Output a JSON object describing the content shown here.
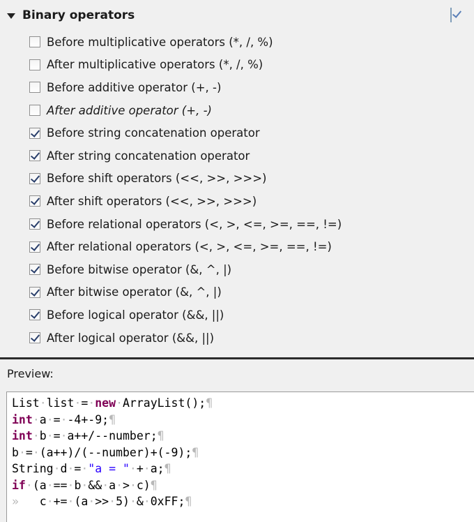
{
  "section": {
    "title": "Binary operators"
  },
  "options": [
    {
      "label": "Before multiplicative operators (*, /, %)",
      "checked": false,
      "italic": false
    },
    {
      "label": "After multiplicative operators (*, /, %)",
      "checked": false,
      "italic": false
    },
    {
      "label": "Before additive operator (+, -)",
      "checked": false,
      "italic": false
    },
    {
      "label": "After additive operator (+, -)",
      "checked": false,
      "italic": true
    },
    {
      "label": "Before string concatenation operator",
      "checked": true,
      "italic": false
    },
    {
      "label": "After string concatenation operator",
      "checked": true,
      "italic": false
    },
    {
      "label": "Before shift operators (<<, >>, >>>)",
      "checked": true,
      "italic": false
    },
    {
      "label": "After shift operators (<<, >>, >>>)",
      "checked": true,
      "italic": false
    },
    {
      "label": "Before relational operators (<, >, <=, >=, ==, !=)",
      "checked": true,
      "italic": false
    },
    {
      "label": "After relational operators (<, >, <=, >=, ==, !=)",
      "checked": true,
      "italic": false
    },
    {
      "label": "Before bitwise operator (&, ^, |)",
      "checked": true,
      "italic": false
    },
    {
      "label": "After bitwise operator (&, ^, |)",
      "checked": true,
      "italic": false
    },
    {
      "label": "Before logical operator (&&, ||)",
      "checked": true,
      "italic": false
    },
    {
      "label": "After logical operator (&&, ||)",
      "checked": true,
      "italic": false
    }
  ],
  "preview": {
    "label": "Preview:",
    "lines": [
      [
        {
          "t": "List"
        },
        {
          "t": "·",
          "c": "ws"
        },
        {
          "t": "list"
        },
        {
          "t": "·",
          "c": "ws"
        },
        {
          "t": "="
        },
        {
          "t": "·",
          "c": "ws"
        },
        {
          "t": "new",
          "c": "kw"
        },
        {
          "t": "·",
          "c": "ws"
        },
        {
          "t": "ArrayList();"
        },
        {
          "t": "¶",
          "c": "ws"
        }
      ],
      [
        {
          "t": "int",
          "c": "kw"
        },
        {
          "t": "·",
          "c": "ws"
        },
        {
          "t": "a"
        },
        {
          "t": "·",
          "c": "ws"
        },
        {
          "t": "="
        },
        {
          "t": "·",
          "c": "ws"
        },
        {
          "t": "-4+-9;"
        },
        {
          "t": "¶",
          "c": "ws"
        }
      ],
      [
        {
          "t": "int",
          "c": "kw"
        },
        {
          "t": "·",
          "c": "ws"
        },
        {
          "t": "b"
        },
        {
          "t": "·",
          "c": "ws"
        },
        {
          "t": "="
        },
        {
          "t": "·",
          "c": "ws"
        },
        {
          "t": "a++/--number;"
        },
        {
          "t": "¶",
          "c": "ws"
        }
      ],
      [
        {
          "t": "b"
        },
        {
          "t": "·",
          "c": "ws"
        },
        {
          "t": "="
        },
        {
          "t": "·",
          "c": "ws"
        },
        {
          "t": "(a++)/(--number)+(-9);"
        },
        {
          "t": "¶",
          "c": "ws"
        }
      ],
      [
        {
          "t": "String"
        },
        {
          "t": "·",
          "c": "ws"
        },
        {
          "t": "d"
        },
        {
          "t": "·",
          "c": "ws"
        },
        {
          "t": "="
        },
        {
          "t": "·",
          "c": "ws"
        },
        {
          "t": "\"a = \"",
          "c": "str"
        },
        {
          "t": "·",
          "c": "ws"
        },
        {
          "t": "+"
        },
        {
          "t": "·",
          "c": "ws"
        },
        {
          "t": "a;"
        },
        {
          "t": "¶",
          "c": "ws"
        }
      ],
      [
        {
          "t": "if",
          "c": "kw"
        },
        {
          "t": "·",
          "c": "ws"
        },
        {
          "t": "(a"
        },
        {
          "t": "·",
          "c": "ws"
        },
        {
          "t": "=="
        },
        {
          "t": "·",
          "c": "ws"
        },
        {
          "t": "b"
        },
        {
          "t": "·",
          "c": "ws"
        },
        {
          "t": "&&"
        },
        {
          "t": "·",
          "c": "ws"
        },
        {
          "t": "a"
        },
        {
          "t": "·",
          "c": "ws"
        },
        {
          "t": ">"
        },
        {
          "t": "·",
          "c": "ws"
        },
        {
          "t": "c)"
        },
        {
          "t": "¶",
          "c": "ws"
        }
      ],
      [
        {
          "t": "»   ",
          "c": "ws"
        },
        {
          "t": "c"
        },
        {
          "t": "·",
          "c": "ws"
        },
        {
          "t": "+="
        },
        {
          "t": "·",
          "c": "ws"
        },
        {
          "t": "(a"
        },
        {
          "t": "·",
          "c": "ws"
        },
        {
          "t": ">>"
        },
        {
          "t": "·",
          "c": "ws"
        },
        {
          "t": "5)"
        },
        {
          "t": "·",
          "c": "ws"
        },
        {
          "t": "&"
        },
        {
          "t": "·",
          "c": "ws"
        },
        {
          "t": "0xFF;"
        },
        {
          "t": "¶",
          "c": "ws"
        }
      ]
    ]
  }
}
